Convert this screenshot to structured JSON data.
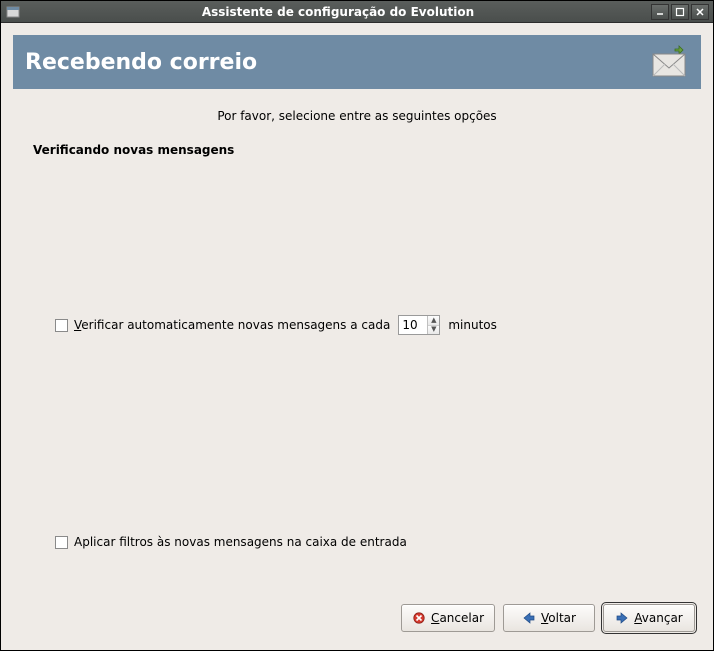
{
  "window": {
    "title": "Assistente de configuração do Evolution"
  },
  "header": {
    "title": "Recebendo correio"
  },
  "instruction": "Por favor, selecione entre as seguintes opções",
  "section_title": "Verificando novas mensagens",
  "options": {
    "auto_check": {
      "prefix1_u": "V",
      "prefix1_rest": "erificar automaticamente novas mensagens a cada",
      "interval": "10",
      "suffix": "minutos",
      "checked": false
    },
    "apply_filters": {
      "label": "Aplicar filtros às novas mensagens na caixa de entrada",
      "checked": false
    }
  },
  "buttons": {
    "cancel_u": "C",
    "cancel_rest": "ancelar",
    "back_u": "V",
    "back_rest": "oltar",
    "forward_u": "A",
    "forward_rest": "vançar"
  }
}
